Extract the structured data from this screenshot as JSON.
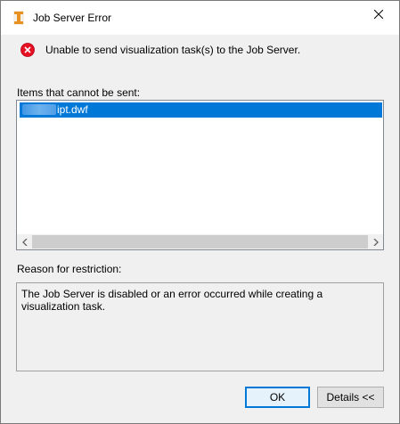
{
  "window": {
    "title": "Job Server Error"
  },
  "message": {
    "icon": "error-icon",
    "text": "Unable to send visualization task(s) to the Job Server."
  },
  "items": {
    "label": "Items that cannot be sent:",
    "list": [
      {
        "name": "ipt.dwf",
        "selected": true
      }
    ]
  },
  "reason": {
    "label": "Reason for restriction:",
    "text": "The Job Server is disabled or an error occurred while creating a visualization task."
  },
  "buttons": {
    "ok": "OK",
    "details": "Details <<"
  },
  "colors": {
    "selection": "#0078d7",
    "error_red": "#e81123",
    "app_icon": "#f0a030"
  }
}
